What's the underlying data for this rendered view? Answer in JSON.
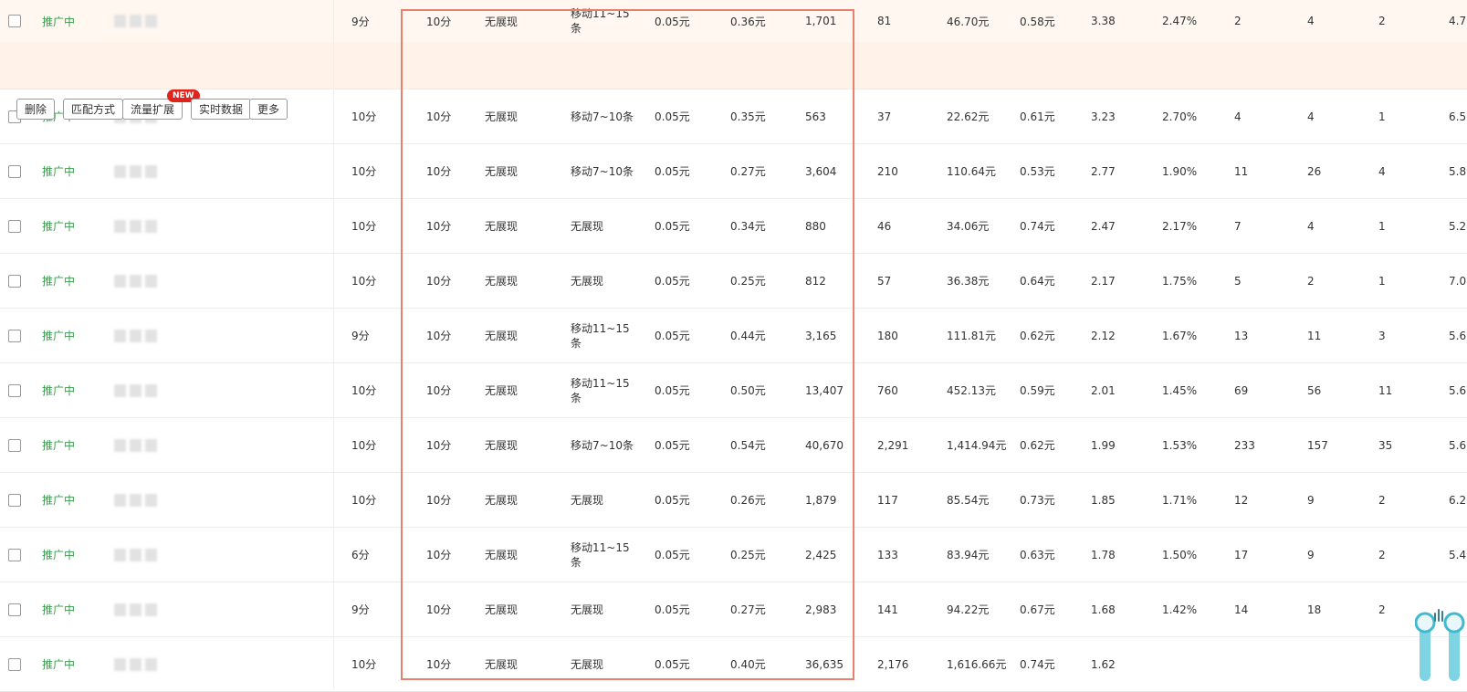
{
  "actions": {
    "delete": "删除",
    "match_type": "匹配方式",
    "traffic_expand": "流量扩展",
    "new_badge": "NEW",
    "realtime": "实时数据",
    "more": "更多"
  },
  "rows": [
    {
      "status": "推广中",
      "score": "9分",
      "c1": "10分",
      "c2": "无展现",
      "c3": "移动11~15条",
      "bid": "0.05元",
      "cpc": "0.36元",
      "impr": "1,701",
      "clicks": "81",
      "cost": "46.70元",
      "avg": "0.58元",
      "ratio": "3.38",
      "ctr": "2.47%",
      "n1": "2",
      "n2": "4",
      "n3": "2",
      "last": "4.7"
    },
    {
      "status": "推广中",
      "score": "10分",
      "c1": "10分",
      "c2": "无展现",
      "c3": "移动7~10条",
      "bid": "0.05元",
      "cpc": "0.35元",
      "impr": "563",
      "clicks": "37",
      "cost": "22.62元",
      "avg": "0.61元",
      "ratio": "3.23",
      "ctr": "2.70%",
      "n1": "4",
      "n2": "4",
      "n3": "1",
      "last": "6.5"
    },
    {
      "status": "推广中",
      "score": "10分",
      "c1": "10分",
      "c2": "无展现",
      "c3": "移动7~10条",
      "bid": "0.05元",
      "cpc": "0.27元",
      "impr": "3,604",
      "clicks": "210",
      "cost": "110.64元",
      "avg": "0.53元",
      "ratio": "2.77",
      "ctr": "1.90%",
      "n1": "11",
      "n2": "26",
      "n3": "4",
      "last": "5.8"
    },
    {
      "status": "推广中",
      "score": "10分",
      "c1": "10分",
      "c2": "无展现",
      "c3": "无展现",
      "bid": "0.05元",
      "cpc": "0.34元",
      "impr": "880",
      "clicks": "46",
      "cost": "34.06元",
      "avg": "0.74元",
      "ratio": "2.47",
      "ctr": "2.17%",
      "n1": "7",
      "n2": "4",
      "n3": "1",
      "last": "5.2"
    },
    {
      "status": "推广中",
      "score": "10分",
      "c1": "10分",
      "c2": "无展现",
      "c3": "无展现",
      "bid": "0.05元",
      "cpc": "0.25元",
      "impr": "812",
      "clicks": "57",
      "cost": "36.38元",
      "avg": "0.64元",
      "ratio": "2.17",
      "ctr": "1.75%",
      "n1": "5",
      "n2": "2",
      "n3": "1",
      "last": "7.0"
    },
    {
      "status": "推广中",
      "score": "9分",
      "c1": "10分",
      "c2": "无展现",
      "c3": "移动11~15条",
      "bid": "0.05元",
      "cpc": "0.44元",
      "impr": "3,165",
      "clicks": "180",
      "cost": "111.81元",
      "avg": "0.62元",
      "ratio": "2.12",
      "ctr": "1.67%",
      "n1": "13",
      "n2": "11",
      "n3": "3",
      "last": "5.6"
    },
    {
      "status": "推广中",
      "score": "10分",
      "c1": "10分",
      "c2": "无展现",
      "c3": "移动11~15条",
      "bid": "0.05元",
      "cpc": "0.50元",
      "impr": "13,407",
      "clicks": "760",
      "cost": "452.13元",
      "avg": "0.59元",
      "ratio": "2.01",
      "ctr": "1.45%",
      "n1": "69",
      "n2": "56",
      "n3": "11",
      "last": "5.6"
    },
    {
      "status": "推广中",
      "score": "10分",
      "c1": "10分",
      "c2": "无展现",
      "c3": "移动7~10条",
      "bid": "0.05元",
      "cpc": "0.54元",
      "impr": "40,670",
      "clicks": "2,291",
      "cost": "1,414.94元",
      "avg": "0.62元",
      "ratio": "1.99",
      "ctr": "1.53%",
      "n1": "233",
      "n2": "157",
      "n3": "35",
      "last": "5.6"
    },
    {
      "status": "推广中",
      "score": "10分",
      "c1": "10分",
      "c2": "无展现",
      "c3": "无展现",
      "bid": "0.05元",
      "cpc": "0.26元",
      "impr": "1,879",
      "clicks": "117",
      "cost": "85.54元",
      "avg": "0.73元",
      "ratio": "1.85",
      "ctr": "1.71%",
      "n1": "12",
      "n2": "9",
      "n3": "2",
      "last": "6.2"
    },
    {
      "status": "推广中",
      "score": "6分",
      "c1": "10分",
      "c2": "无展现",
      "c3": "移动11~15条",
      "bid": "0.05元",
      "cpc": "0.25元",
      "impr": "2,425",
      "clicks": "133",
      "cost": "83.94元",
      "avg": "0.63元",
      "ratio": "1.78",
      "ctr": "1.50%",
      "n1": "17",
      "n2": "9",
      "n3": "2",
      "last": "5.4"
    },
    {
      "status": "推广中",
      "score": "9分",
      "c1": "10分",
      "c2": "无展现",
      "c3": "无展现",
      "bid": "0.05元",
      "cpc": "0.27元",
      "impr": "2,983",
      "clicks": "141",
      "cost": "94.22元",
      "avg": "0.67元",
      "ratio": "1.68",
      "ctr": "1.42%",
      "n1": "14",
      "n2": "18",
      "n3": "2",
      "last": ""
    },
    {
      "status": "推广中",
      "score": "10分",
      "c1": "10分",
      "c2": "无展现",
      "c3": "无展现",
      "bid": "0.05元",
      "cpc": "0.40元",
      "impr": "36,635",
      "clicks": "2,176",
      "cost": "1,616.66元",
      "avg": "0.74元",
      "ratio": "1.62",
      "ctr": "",
      "n1": "",
      "n2": "",
      "n3": "",
      "last": ""
    }
  ]
}
